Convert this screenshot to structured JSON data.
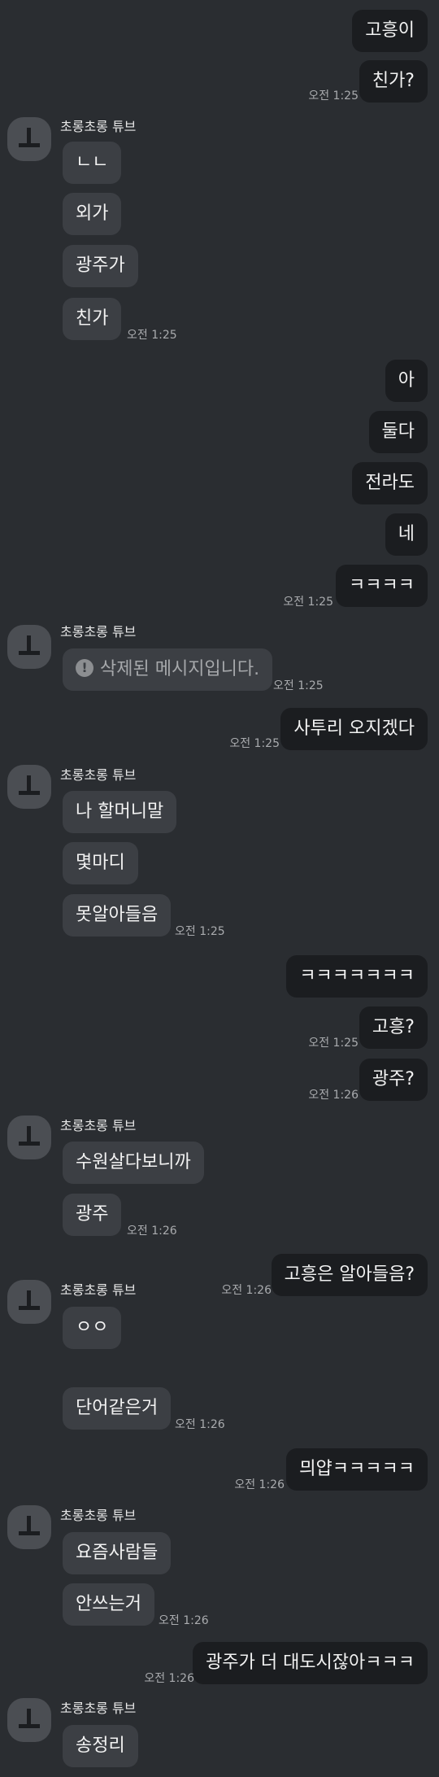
{
  "chat": {
    "sender_name": "초롱초롱 튜브",
    "deleted_label": "삭제된 메시지입니다.",
    "messages": [
      {
        "text": "고흥이"
      },
      {
        "text": "친가?",
        "time": "오전 1:25"
      },
      {
        "text": "ㄴㄴ"
      },
      {
        "text": "외가"
      },
      {
        "text": "광주가"
      },
      {
        "text": "친가",
        "time": "오전 1:25"
      },
      {
        "text": "아"
      },
      {
        "text": "둘다"
      },
      {
        "text": "전라도"
      },
      {
        "text": "네"
      },
      {
        "text": "ㅋㅋㅋㅋ",
        "time": "오전 1:25"
      },
      {
        "time": "오전 1:25"
      },
      {
        "text": "사투리 오지겠다",
        "time": "오전 1:25"
      },
      {
        "text": "나 할머니말"
      },
      {
        "text": "몇마디"
      },
      {
        "text": "못알아들음",
        "time": "오전 1:25"
      },
      {
        "text": "ㅋㅋㅋㅋㅋㅋㅋ"
      },
      {
        "text": "고흥?",
        "time": "오전 1:25"
      },
      {
        "text": "광주?",
        "time": "오전 1:26"
      },
      {
        "text": "수원살다보니까"
      },
      {
        "text": "광주",
        "time": "오전 1:26"
      },
      {
        "text": "고흥은 알아들음?",
        "time": "오전 1:26"
      },
      {
        "text": "ㅇㅇ"
      },
      {
        "text": "단어같은거",
        "time": "오전 1:26"
      },
      {
        "text": "믜얍ㅋㅋㅋㅋㅋ",
        "time": "오전 1:26"
      },
      {
        "text": "요즘사람들"
      },
      {
        "text": "안쓰는거",
        "time": "오전 1:26"
      },
      {
        "text": "광주가 더 대도시잖아ㅋㅋㅋ",
        "time": "오전 1:26"
      },
      {
        "text": "송정리"
      }
    ]
  }
}
